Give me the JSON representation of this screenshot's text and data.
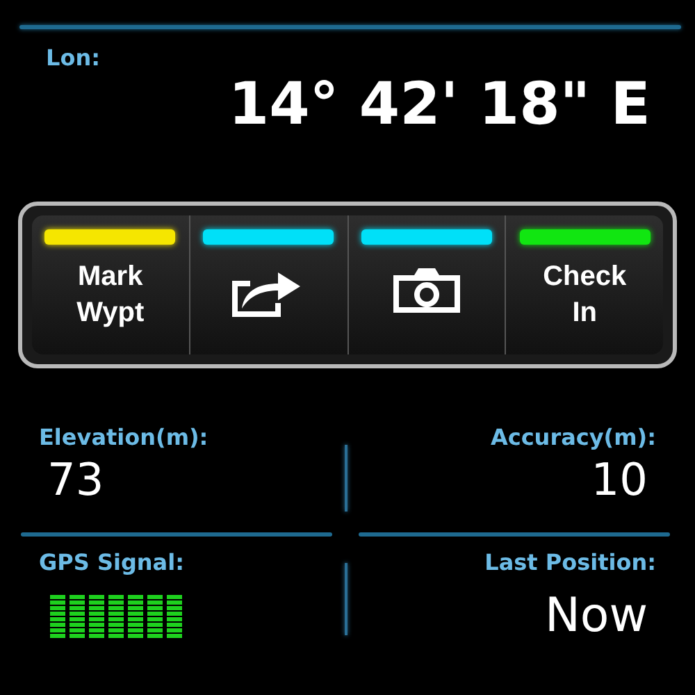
{
  "longitude": {
    "label": "Lon:",
    "value": "14° 42' 18\" E"
  },
  "actions": [
    {
      "kind": "text",
      "label": "Mark\nWypt",
      "color": "#f5e600"
    },
    {
      "kind": "share",
      "color": "#00e0f8"
    },
    {
      "kind": "camera",
      "color": "#00e0f8"
    },
    {
      "kind": "text",
      "label": "Check\nIn",
      "color": "#11e611"
    }
  ],
  "stats": [
    {
      "kind": "text",
      "label": "Elevation(m):",
      "value": "73"
    },
    {
      "kind": "text",
      "label": "Accuracy(m):",
      "value": "10"
    },
    {
      "kind": "signal",
      "label": "GPS Signal:"
    },
    {
      "kind": "text",
      "label": "Last Position:",
      "value": "Now"
    }
  ]
}
